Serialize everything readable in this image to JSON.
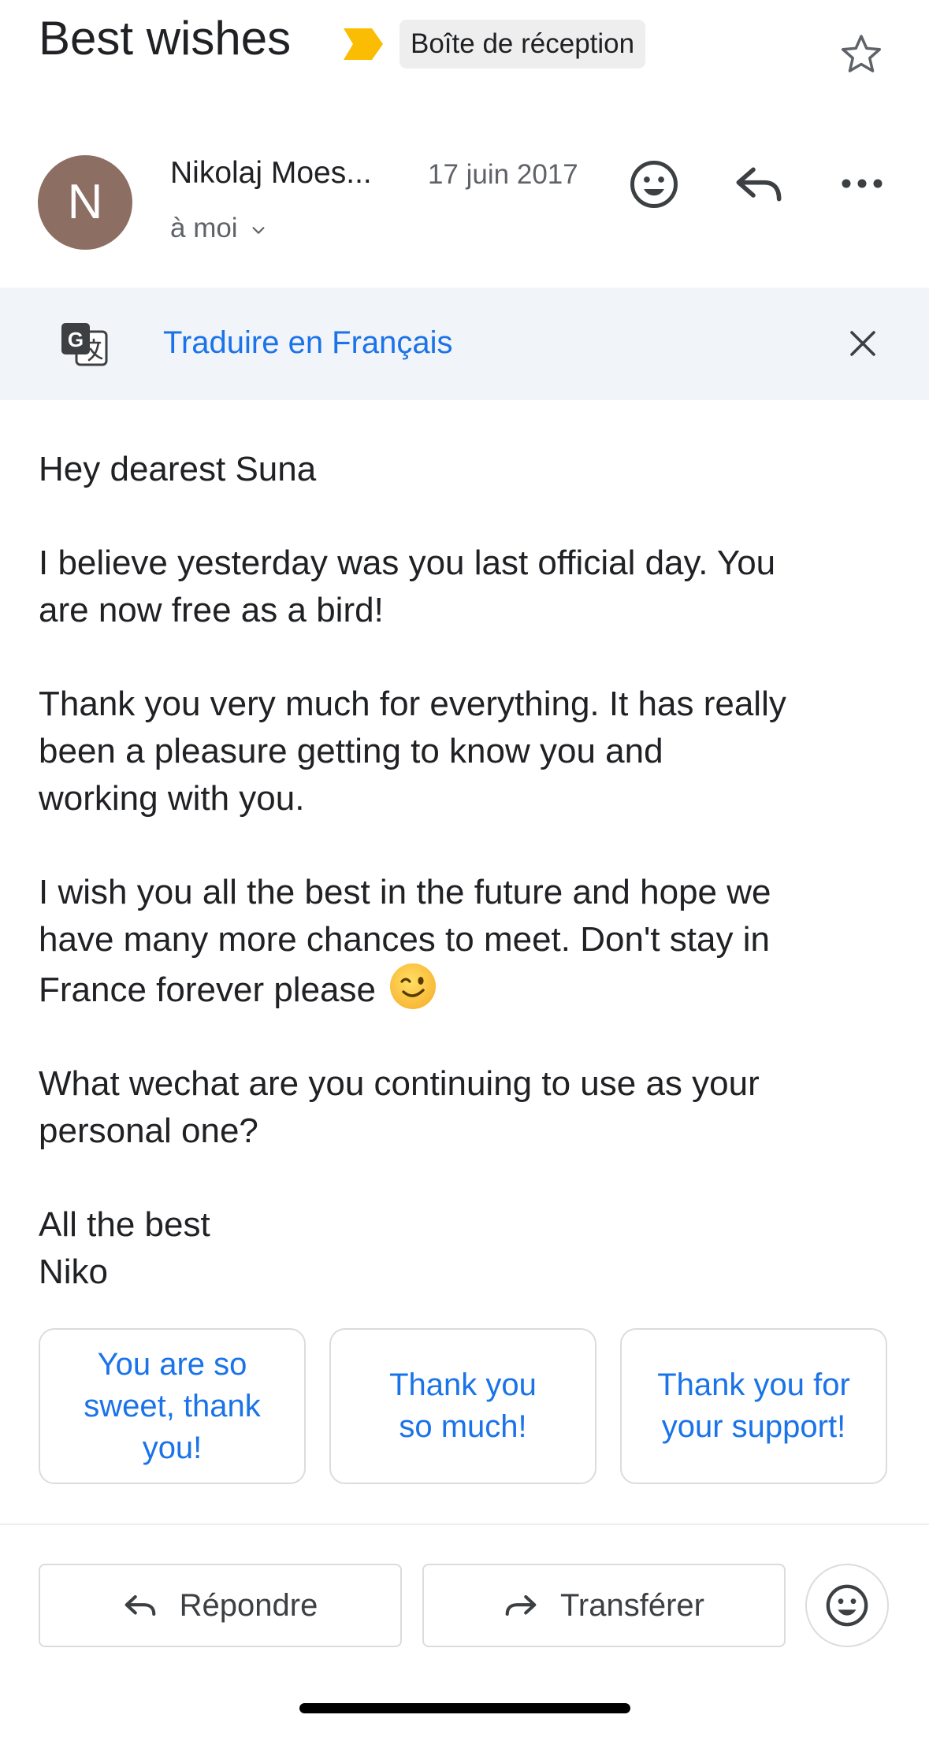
{
  "header": {
    "subject": "Best wishes",
    "label": "Boîte de réception",
    "important_icon": "important-marker-icon",
    "star_icon": "star-icon"
  },
  "sender": {
    "avatar_letter": "N",
    "avatar_color": "#8d6e63",
    "name": "Nikolaj Moes...",
    "date": "17 juin 2017",
    "recipient": "à moi",
    "icons": [
      "smiley-icon",
      "reply-icon",
      "more-icon"
    ]
  },
  "translate": {
    "link": "Traduire en Français",
    "icon": "google-translate-icon",
    "close_icon": "close-icon"
  },
  "body": {
    "paragraphs": [
      [
        "Hey dearest Suna"
      ],
      [
        "I believe yesterday was you last official day. You",
        "are now free as a bird!"
      ],
      [
        "Thank you very much for everything. It has really",
        "been a pleasure getting to know you and",
        "working with you."
      ],
      [
        "I wish you all the best in the future and hope we",
        "have many more chances to meet. Don't stay in",
        "France forever please"
      ],
      [
        "What wechat are you continuing to use as your",
        "personal one?"
      ],
      [
        "All the best",
        "Niko"
      ]
    ],
    "emoji": "winking-face-emoji"
  },
  "smart_replies": [
    [
      "You are so",
      "sweet, thank",
      "you!"
    ],
    [
      "Thank you",
      "so much!"
    ],
    [
      "Thank you for",
      "your support!"
    ]
  ],
  "actions": {
    "reply": "Répondre",
    "forward": "Transférer",
    "emoji_icon": "smiley-icon"
  },
  "colors": {
    "accent": "#1a73e8",
    "important": "#fbbc04",
    "translate_bar": "#f1f4f9"
  }
}
